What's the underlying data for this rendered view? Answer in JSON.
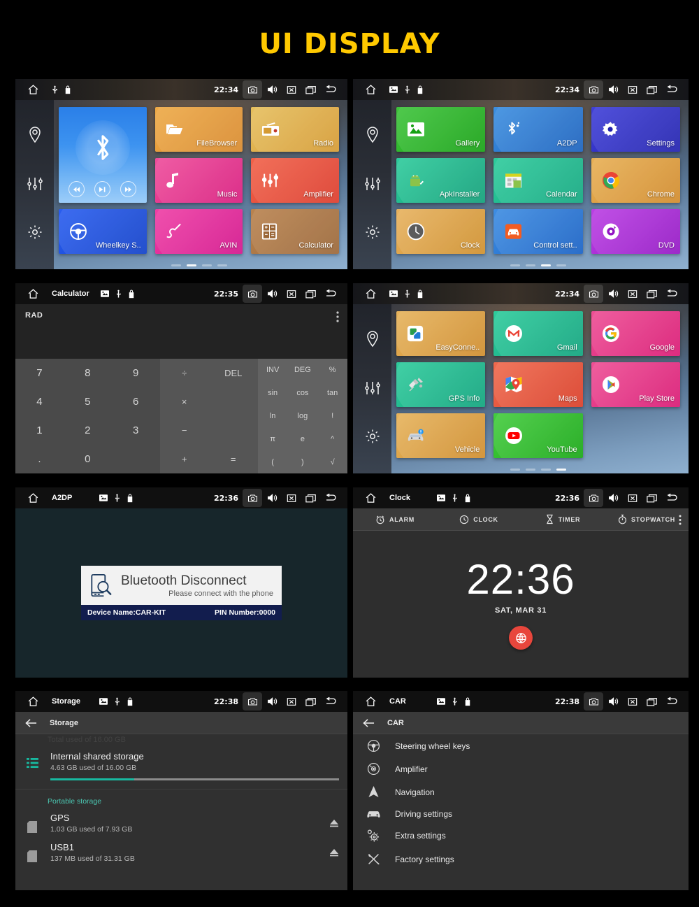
{
  "header": {
    "title": "UI DISPLAY",
    "color": "#FFC900"
  },
  "statusbar": {
    "icons": [
      "home-icon",
      "sd-card-icon",
      "usb-icon",
      "lock-icon"
    ],
    "right_icons": [
      "camera-icon",
      "volume-icon",
      "close-icon",
      "recents-icon",
      "back-icon"
    ]
  },
  "panels": [
    {
      "id": "home-launcher-page2",
      "statusbar": {
        "title": "",
        "time": "22:34"
      },
      "sidebar": [
        "navigation-pin-icon",
        "equalizer-icon",
        "settings-gear-icon"
      ],
      "widget": {
        "name": "Bluetooth",
        "controls": [
          "prev-track",
          "play-pause",
          "next-track"
        ]
      },
      "apps": [
        {
          "label": "FileBrowser",
          "icon": "folder-icon",
          "color": "#e8a33d"
        },
        {
          "label": "Radio",
          "icon": "radio-icon",
          "color": "#e0b14a"
        },
        {
          "label": "Music",
          "icon": "music-note-icon",
          "color": "#e8308a"
        },
        {
          "label": "Amplifier",
          "icon": "equalizer-icon",
          "color": "#e8503a"
        },
        {
          "label": "Wheelkey S..",
          "icon": "steering-wheel-icon",
          "color": "#1a50dd"
        },
        {
          "label": "AVIN",
          "icon": "avin-plug-icon",
          "color": "#e0289a"
        },
        {
          "label": "Calculator",
          "icon": "calculator-icon",
          "color": "#a97445"
        }
      ],
      "page_dots": {
        "count": 4,
        "active": 1
      }
    },
    {
      "id": "home-launcher-page3",
      "statusbar": {
        "title": "",
        "time": "22:34"
      },
      "sidebar": [
        "navigation-pin-icon",
        "equalizer-icon",
        "settings-gear-icon"
      ],
      "apps": [
        {
          "label": "Gallery",
          "icon": "image-icon",
          "color": "#2aa828"
        },
        {
          "label": "A2DP",
          "icon": "bluetooth-audio-icon",
          "color": "#1f6fcc"
        },
        {
          "label": "Settings",
          "icon": "gear-icon",
          "color": "#2b2bbe"
        },
        {
          "label": "ApkInstaller",
          "icon": "android-icon",
          "color": "#16b184"
        },
        {
          "label": "Calendar",
          "icon": "calendar-icon",
          "color": "#16b184"
        },
        {
          "label": "Chrome",
          "icon": "chrome-icon",
          "color": "#e09a35"
        },
        {
          "label": "Clock",
          "icon": "clock-icon",
          "color": "#e0a13a"
        },
        {
          "label": "Control sett..",
          "icon": "car-icon",
          "color": "#1f72d2"
        },
        {
          "label": "DVD",
          "icon": "disc-icon",
          "color": "#a32ad4"
        }
      ],
      "page_dots": {
        "count": 4,
        "active": 2
      }
    },
    {
      "id": "calculator",
      "statusbar": {
        "title": "Calculator",
        "time": "22:35"
      },
      "mode": "RAD",
      "numeric_keys": [
        "7",
        "8",
        "9",
        "4",
        "5",
        "6",
        "1",
        "2",
        "3",
        ".",
        "0",
        ""
      ],
      "operator_keys": [
        "÷",
        "DEL",
        "×",
        "",
        "−",
        "",
        "+",
        "="
      ],
      "scientific_keys": [
        "INV",
        "DEG",
        "%",
        "sin",
        "cos",
        "tan",
        "ln",
        "log",
        "!",
        "π",
        "e",
        "^",
        "(",
        ")",
        "√"
      ],
      "overflow": "kebab-menu-icon"
    },
    {
      "id": "a2dp-bluetooth",
      "statusbar": {
        "title": "A2DP",
        "time": "22:36"
      },
      "card": {
        "title": "Bluetooth Disconnect",
        "subtitle": "Please connect with the phone",
        "device_name": "Device Name:CAR-KIT",
        "pin": "PIN Number:0000",
        "icon": "phone-search-icon"
      }
    },
    {
      "id": "home-launcher-page4",
      "statusbar": {
        "title": "",
        "time": "22:34"
      },
      "sidebar": [
        "navigation-pin-icon",
        "equalizer-icon",
        "settings-gear-icon"
      ],
      "apps": [
        {
          "label": "EasyConne..",
          "icon": "easyconnect-icon",
          "color": "#dca040"
        },
        {
          "label": "Gmail",
          "icon": "gmail-icon",
          "color": "#16b487"
        },
        {
          "label": "Google",
          "icon": "google-g-icon",
          "color": "#e52f82"
        },
        {
          "label": "GPS Info",
          "icon": "satellite-icon",
          "color": "#16b487"
        },
        {
          "label": "Maps",
          "icon": "maps-pin-icon",
          "color": "#e2503a"
        },
        {
          "label": "Play Store",
          "icon": "play-store-icon",
          "color": "#e52f82"
        },
        {
          "label": "Vehicle",
          "icon": "vehicle-car-icon",
          "color": "#dca040"
        },
        {
          "label": "YouTube",
          "icon": "youtube-icon",
          "color": "#2cb12c"
        }
      ],
      "page_dots": {
        "count": 4,
        "active": 3
      }
    },
    {
      "id": "clock",
      "statusbar": {
        "title": "Clock",
        "time": "22:36"
      },
      "tabs": [
        {
          "label": "ALARM",
          "icon": "alarm-icon"
        },
        {
          "label": "CLOCK",
          "icon": "clock-icon"
        },
        {
          "label": "TIMER",
          "icon": "hourglass-icon"
        },
        {
          "label": "STOPWATCH",
          "icon": "stopwatch-icon"
        }
      ],
      "time": "22:36",
      "date": "SAT, MAR 31",
      "fab": "world-clock-icon",
      "overflow": "kebab-menu-icon"
    },
    {
      "id": "storage-settings",
      "statusbar": {
        "title": "Storage",
        "time": "22:38"
      },
      "appbar_title": "Storage",
      "faded_row": "Total used of 16.00 GB",
      "internal": {
        "name": "Internal shared storage",
        "usage": "4.63 GB used of 16.00 GB",
        "percent": 29,
        "bar_color": "#18b9a0",
        "icon": "storage-list-icon"
      },
      "section_header": "Portable storage",
      "portable": [
        {
          "name": "GPS",
          "usage": "1.03 GB used of 7.93 GB",
          "icon": "sd-card-icon",
          "action": "eject-icon"
        },
        {
          "name": "USB1",
          "usage": "137 MB used of 31.31 GB",
          "icon": "sd-card-icon",
          "action": "eject-icon"
        }
      ]
    },
    {
      "id": "car-settings",
      "statusbar": {
        "title": "CAR",
        "time": "22:38"
      },
      "appbar_title": "CAR",
      "items": [
        {
          "label": "Steering wheel keys",
          "icon": "steering-wheel-icon"
        },
        {
          "label": "Amplifier",
          "icon": "amplifier-icon"
        },
        {
          "label": "Navigation",
          "icon": "navigation-arrow-icon"
        },
        {
          "label": "Driving settings",
          "icon": "car-icon"
        },
        {
          "label": "Extra settings",
          "icon": "gears-icon"
        },
        {
          "label": "Factory settings",
          "icon": "tools-icon"
        }
      ]
    }
  ]
}
